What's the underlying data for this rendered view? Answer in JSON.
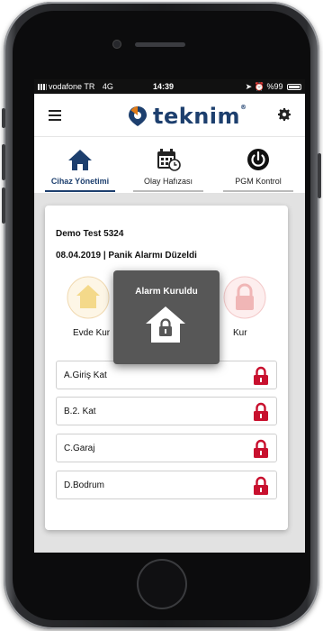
{
  "status_bar": {
    "carrier": "vodafone TR",
    "network": "4G",
    "time": "14:39",
    "battery": "%99"
  },
  "header": {
    "logo_text": "teknim",
    "logo_reg": "®",
    "brand_color": "#1d3f6e"
  },
  "tabs": [
    {
      "label": "Cihaz Yönetimi",
      "icon": "home-icon",
      "active": true
    },
    {
      "label": "Olay Hafızası",
      "icon": "calendar-clock-icon",
      "active": false
    },
    {
      "label": "PGM Kontrol",
      "icon": "power-icon",
      "active": false
    }
  ],
  "device": {
    "name": "Demo Test 5324",
    "last_event": "08.04.2019 | Panik Alarmı Düzeldi"
  },
  "arm_buttons": {
    "home": "Evde Kur",
    "away": "Kur"
  },
  "zones": [
    {
      "name": "A.Giriş Kat",
      "status": "armed"
    },
    {
      "name": "B.2. Kat",
      "status": "armed"
    },
    {
      "name": "C.Garaj",
      "status": "armed"
    },
    {
      "name": "D.Bodrum",
      "status": "armed"
    }
  ],
  "popup": {
    "title": "Alarm Kuruldu",
    "icon": "house-lock-icon"
  },
  "colors": {
    "lock_red": "#c8102e",
    "popup_bg": "#575757"
  }
}
